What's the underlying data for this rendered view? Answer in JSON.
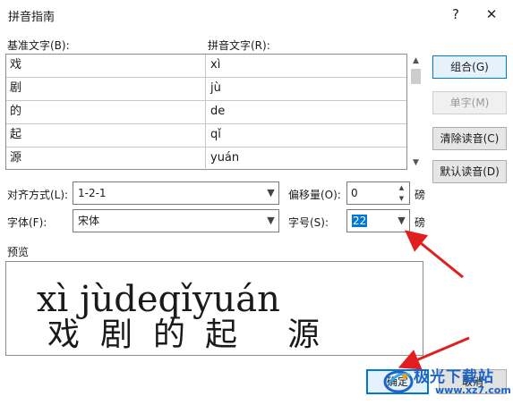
{
  "window": {
    "title": "拼音指南",
    "help_glyph": "?",
    "close_glyph": "✕"
  },
  "labels": {
    "base_text": "基准文字(B):",
    "pinyin_text": "拼音文字(R):",
    "alignment": "对齐方式(L):",
    "offset": "偏移量(O):",
    "offset_unit": "磅",
    "font": "字体(F):",
    "size": "字号(S):",
    "size_unit": "磅",
    "preview": "预览"
  },
  "rows": [
    {
      "base": "戏",
      "pinyin": "xì"
    },
    {
      "base": "剧",
      "pinyin": "jù"
    },
    {
      "base": "的",
      "pinyin": "de"
    },
    {
      "base": "起",
      "pinyin": "qǐ"
    },
    {
      "base": "源",
      "pinyin": "yuán"
    }
  ],
  "side_buttons": {
    "group": "组合(G)",
    "single": "单字(M)",
    "clear": "清除读音(C)",
    "default": "默认读音(D)"
  },
  "alignment_value": "1-2-1",
  "offset_value": "0",
  "font_value": "宋体",
  "size_value": "22",
  "preview": {
    "pinyin": [
      "xì",
      "jù",
      "de",
      "qǐ",
      "yuán"
    ],
    "chars": [
      "戏",
      "剧",
      "的",
      "起",
      "源"
    ]
  },
  "footer": {
    "ok": "确定",
    "cancel": "取消"
  },
  "watermark": {
    "name": "极光下载站",
    "url": "www.xz7.com"
  },
  "colors": {
    "accent": "#0078d7",
    "arrow": "#e02020",
    "watermark": "#1d64c8"
  },
  "icons": {
    "combo_dropdown": "chevron-down-icon",
    "spin": "spin-arrows-icon",
    "annotation": "red-arrow"
  }
}
